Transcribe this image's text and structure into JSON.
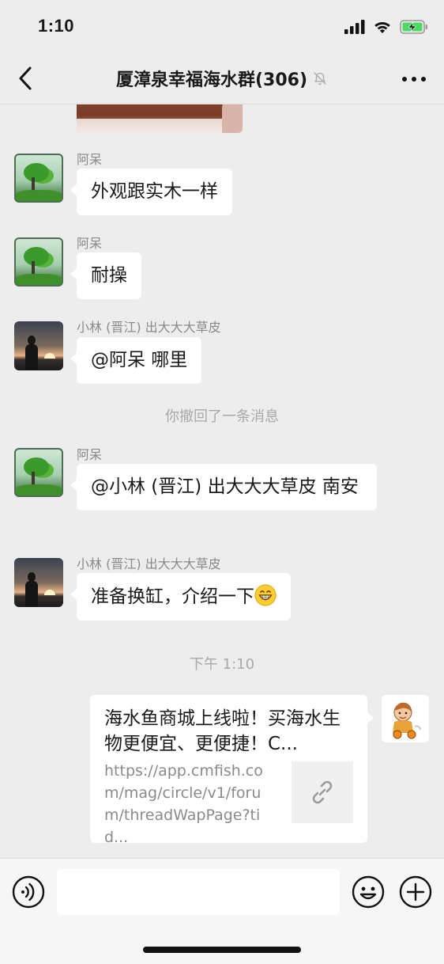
{
  "status_bar": {
    "time": "1:10"
  },
  "header": {
    "title": "厦漳泉幸福海水群(306)",
    "muted": true
  },
  "messages": [
    {
      "sender": "阿呆",
      "text": "外观跟实木一样"
    },
    {
      "sender": "阿呆",
      "text": "耐操"
    },
    {
      "sender": "小林 (晋江) 出大大大草皮",
      "text": "@阿呆 哪里"
    },
    {
      "system": "你撤回了一条消息"
    },
    {
      "sender": "阿呆",
      "text": "@小林 (晋江) 出大大大草皮 南安"
    },
    {
      "sender": "小林 (晋江) 出大大大草皮",
      "text": "准备换缸，介绍一下"
    },
    {
      "system": "下午 1:10"
    }
  ],
  "link_card": {
    "title": "海水鱼商城上线啦！买海水生物更便宜、更便捷！C...",
    "url": "https://app.cmfish.com/mag/circle/v1/forum/threadWapPage?tid...",
    "thumb_icon": "link-icon"
  },
  "input_bar": {
    "placeholder": "",
    "voice_icon": "voice-icon",
    "emoji_icon": "emoji-icon",
    "plus_icon": "plus-icon"
  },
  "colors": {
    "background": "#ededed",
    "bubble": "#ffffff",
    "system_text": "#a8a8a8"
  }
}
